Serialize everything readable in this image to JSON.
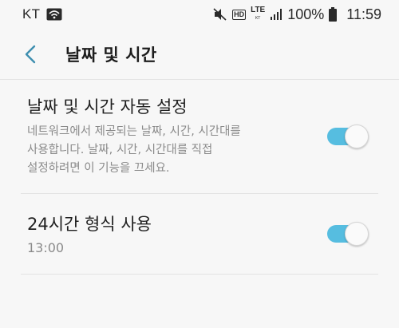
{
  "status_bar": {
    "carrier": "KT",
    "hd_label": "HD",
    "lte_label": "LTE",
    "lte_sub": "KT",
    "battery_percent": "100%",
    "time": "11:59",
    "icons": [
      "wifi-icon",
      "mute-icon",
      "signal-icon",
      "battery-icon"
    ]
  },
  "header": {
    "title": "날짜 및 시간"
  },
  "settings": [
    {
      "title": "날짜 및 시간 자동 설정",
      "description": "네트워크에서 제공되는 날짜, 시간, 시간대를\n사용합니다. 날짜, 시간, 시간대를 직접\n설정하려면 이 기능을 끄세요.",
      "enabled": true
    },
    {
      "title": "24시간 형식 사용",
      "description": "13:00",
      "enabled": true
    }
  ],
  "colors": {
    "accent": "#56bde0",
    "back_arrow": "#3f8fb0",
    "background": "#f7f7f7"
  }
}
